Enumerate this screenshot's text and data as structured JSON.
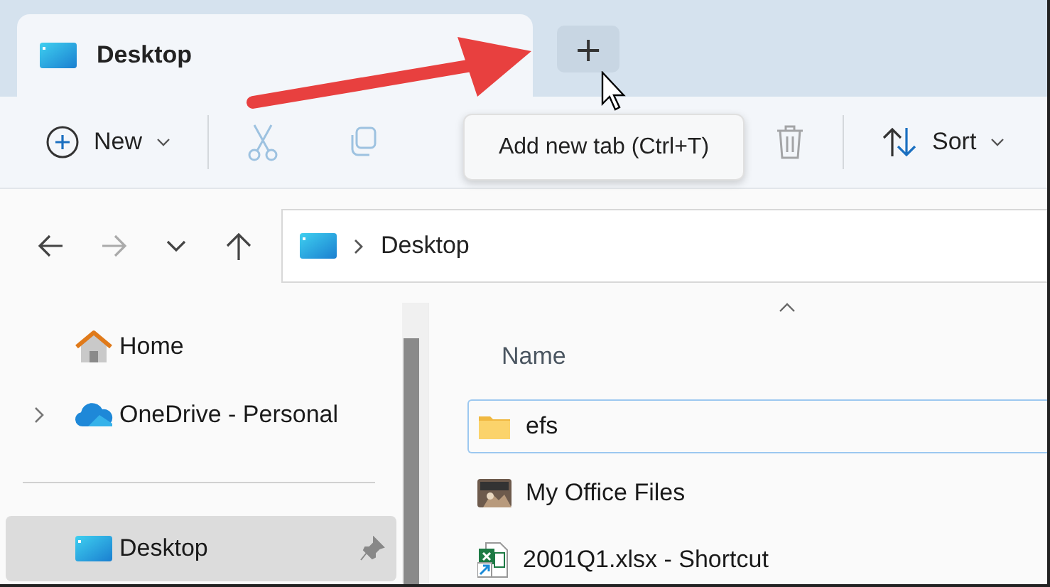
{
  "tabs": [
    {
      "label": "Desktop",
      "selected": true
    }
  ],
  "new_tab_button": {
    "label": "+"
  },
  "tooltip": {
    "text": "Add new tab (Ctrl+T)"
  },
  "toolbar": [
    {
      "kind": "new",
      "label": "New",
      "disabled": false
    },
    {
      "kind": "cut",
      "disabled": true
    },
    {
      "kind": "copy",
      "disabled": true
    },
    {
      "kind": "delete",
      "disabled": true
    },
    {
      "kind": "sort",
      "label": "Sort",
      "disabled": false
    }
  ],
  "navigation": {
    "back_disabled": false,
    "forward_disabled": true,
    "up_disabled": false
  },
  "address_bar": {
    "path": [
      "Desktop"
    ]
  },
  "sidebar": {
    "groups": [
      [
        {
          "kind": "home",
          "label": "Home",
          "expandable": false,
          "selected": false,
          "pinned": false
        },
        {
          "kind": "onedrive",
          "label": "OneDrive - Personal",
          "expandable": true,
          "selected": false,
          "pinned": false
        }
      ],
      [
        {
          "kind": "desktop",
          "label": "Desktop",
          "expandable": false,
          "selected": true,
          "pinned": true
        }
      ]
    ]
  },
  "file_list": {
    "columns": [
      {
        "label": "Name",
        "sorted": true
      }
    ],
    "rows": [
      {
        "kind": "folder",
        "name": "efs",
        "focused": true
      },
      {
        "name": "My Office Files",
        "focused": false
      },
      {
        "kind": "excel-shortcut",
        "name": "2001Q1.xlsx - Shortcut",
        "focused": false
      }
    ]
  }
}
